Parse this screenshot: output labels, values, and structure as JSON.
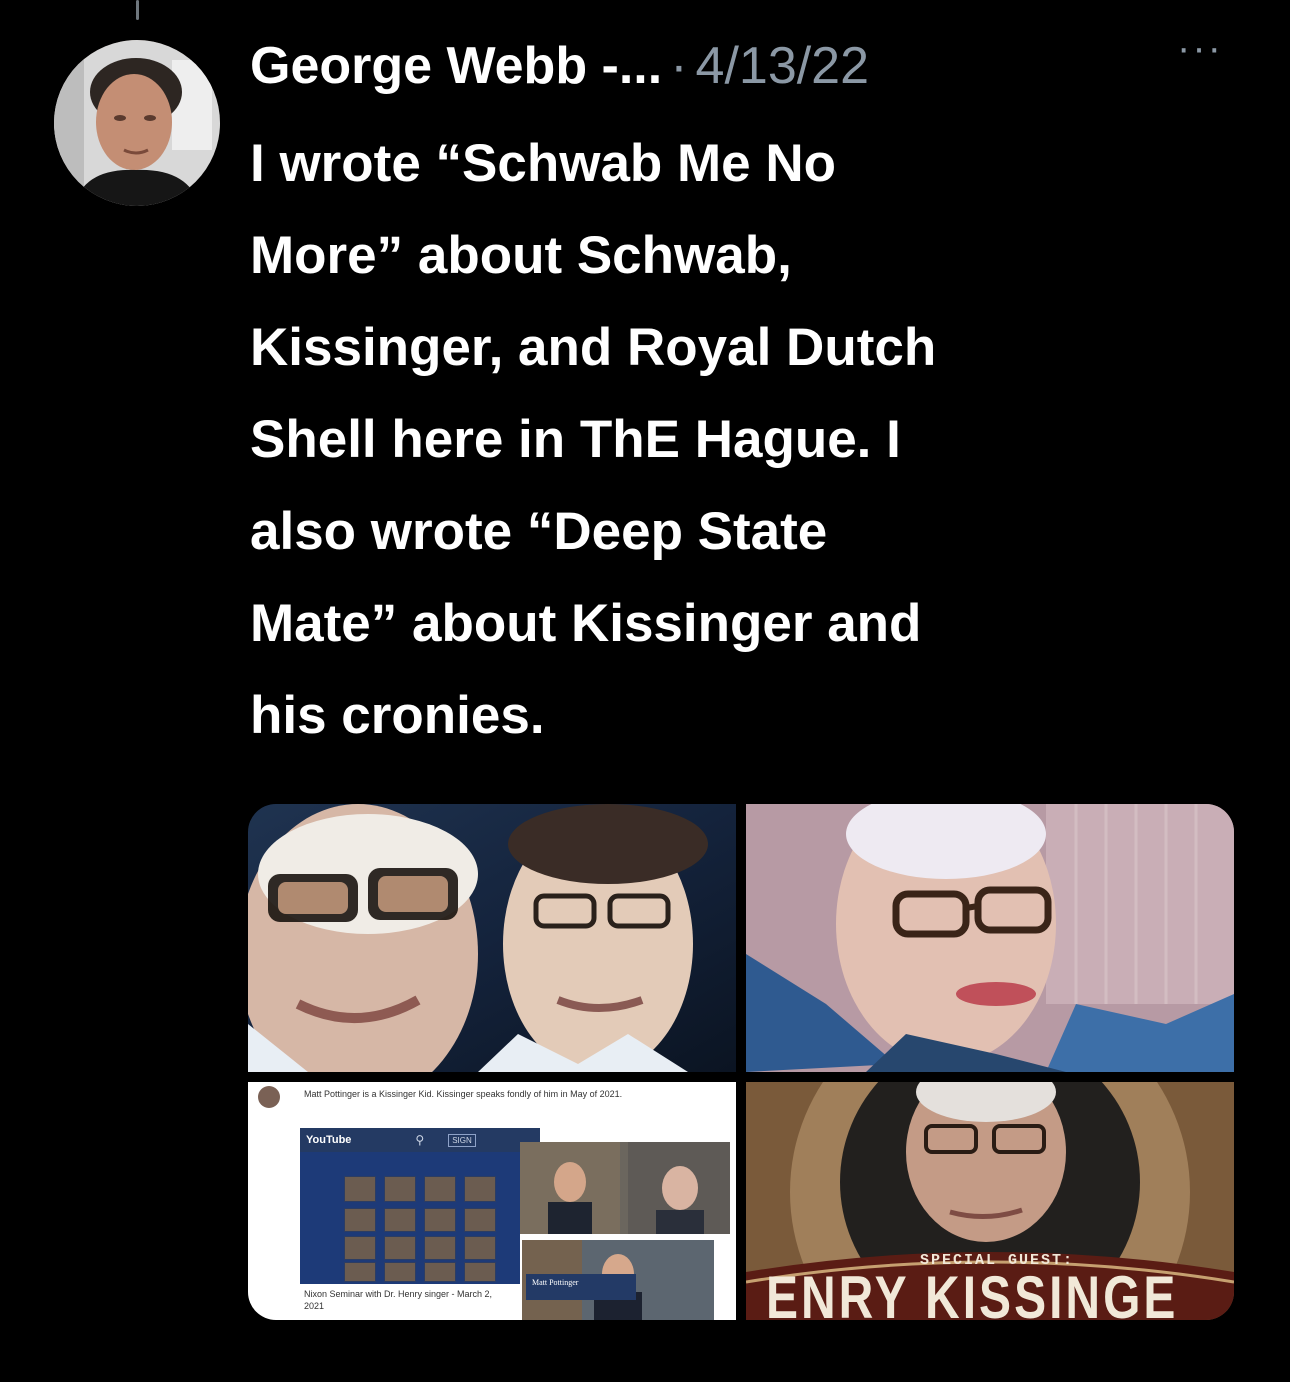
{
  "tweet": {
    "author_name": "George Webb -...",
    "separator": "·",
    "timestamp": "4/13/22",
    "more_label": "···",
    "text": "I wrote “Schwab Me No\nMore” about Schwab,\nKissinger, and Royal Dutch\nShell here in ThE Hague. I\nalso wrote “Deep State\nMate” about Kissinger and\nhis cronies."
  },
  "media": {
    "tile3": {
      "caption": "Matt Pottinger is a Kissinger Kid. Kissinger speaks fondly of him in May of 2021.",
      "youtube_label": "YouTube",
      "search_icon": "search-icon",
      "sign_label": "SIGN",
      "nixon_caption": "Nixon Seminar with Dr. Henry singer - March 2, 2021",
      "pottinger_tag": "Matt Pottinger"
    },
    "tile4": {
      "special_guest": "SPECIAL GUEST:",
      "name_banner": "ENRY KISSINGE"
    }
  },
  "icons": {
    "more": "more-horizontal-icon",
    "avatar": "user-avatar"
  },
  "colors": {
    "background": "#000000",
    "text": "#ffffff",
    "muted": "#8b98a5"
  }
}
